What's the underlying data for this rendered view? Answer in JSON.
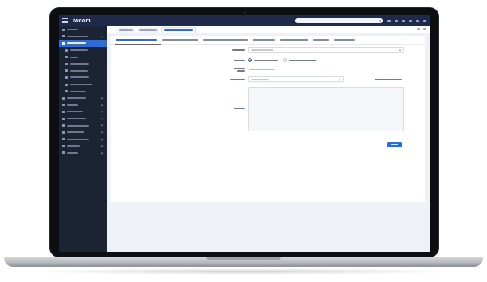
{
  "app": {
    "logo": "iwcom",
    "title": ""
  },
  "topbar": {
    "search_placeholder": ""
  },
  "sidebar": {
    "items": [
      {
        "label": "",
        "active": false
      },
      {
        "label": "",
        "active": false
      },
      {
        "label": "",
        "active": true
      },
      {
        "label": "",
        "active": false,
        "sub": true
      },
      {
        "label": "",
        "active": false,
        "sub": true
      },
      {
        "label": "",
        "active": false,
        "sub": true
      },
      {
        "label": "",
        "active": false,
        "sub": true
      },
      {
        "label": "",
        "active": false,
        "sub": true
      },
      {
        "label": "",
        "active": false,
        "sub": true
      },
      {
        "label": "",
        "active": false,
        "sub": true
      },
      {
        "label": "",
        "active": false
      },
      {
        "label": "",
        "active": false
      },
      {
        "label": "",
        "active": false
      },
      {
        "label": "",
        "active": false
      },
      {
        "label": "",
        "active": false
      },
      {
        "label": "",
        "active": false
      },
      {
        "label": "",
        "active": false
      },
      {
        "label": "",
        "active": false
      },
      {
        "label": "",
        "active": false
      }
    ]
  },
  "tabs": [
    {
      "label": "",
      "active": false
    },
    {
      "label": "",
      "active": false
    },
    {
      "label": "",
      "active": true
    }
  ],
  "subtabs": [
    {
      "label": "",
      "active": true
    },
    {
      "label": "",
      "active": false
    },
    {
      "label": "",
      "active": false
    },
    {
      "label": "",
      "active": false
    },
    {
      "label": "",
      "active": false
    },
    {
      "label": "",
      "active": false
    },
    {
      "label": "",
      "active": false
    }
  ],
  "form": {
    "field_1": {
      "label": "",
      "value": ""
    },
    "field_2": {
      "label": "",
      "options": [
        "",
        ""
      ]
    },
    "field_3": {
      "label": "",
      "value": ""
    },
    "field_4": {
      "label": "",
      "value": "",
      "right_label": ""
    },
    "field_5": {
      "label": ""
    },
    "submit": ""
  },
  "colors": {
    "accent": "#2f6bd8",
    "sidebar_bg": "#1c2333",
    "topbar_bg": "#1f2a4a",
    "content_bg": "#eef1f6"
  }
}
